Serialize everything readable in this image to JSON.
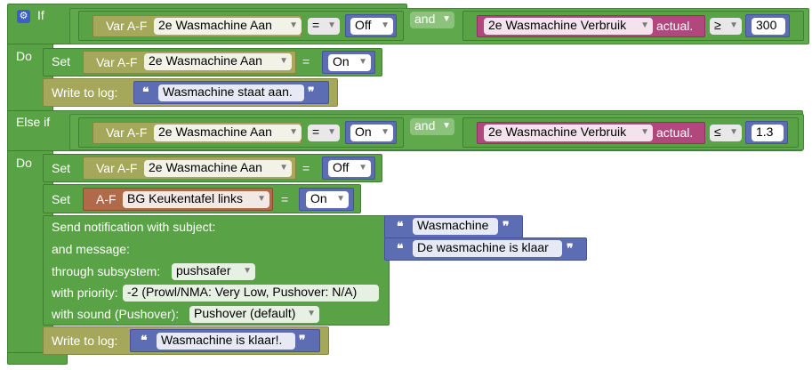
{
  "if_block": {
    "label_if": "If",
    "label_do": "Do",
    "label_else_if": "Else if",
    "label_do2": "Do"
  },
  "cond1": {
    "left_var_label": "Var A-F",
    "left_device": "2e Wasmachine Aan",
    "op": "=",
    "value": "Off",
    "and": "and",
    "right_device": "2e Wasmachine Verbruik",
    "right_suffix": "actual.",
    "cmp": "≥",
    "number": "300"
  },
  "do1": {
    "set_label": "Set",
    "var_label": "Var A-F",
    "device": "2e Wasmachine Aan",
    "eq": "=",
    "value": "On",
    "log_label": "Write to log:",
    "log_text": "Wasmachine staat aan."
  },
  "cond2": {
    "left_var_label": "Var A-F",
    "left_device": "2e Wasmachine Aan",
    "op": "=",
    "value": "On",
    "and": "and",
    "right_device": "2e Wasmachine Verbruik",
    "right_suffix": "actual.",
    "cmp": "≤",
    "number": "1.3"
  },
  "do2": {
    "set1_label": "Set",
    "set1_var_label": "Var A-F",
    "set1_device": "2e Wasmachine Aan",
    "set1_eq": "=",
    "set1_value": "Off",
    "set2_label": "Set",
    "set2_var_label": "A-F",
    "set2_device": "BG Keukentafel links",
    "set2_eq": "=",
    "set2_value": "On",
    "notify": {
      "subject_label": "Send notification with subject:",
      "subject_text": "Wasmachine",
      "message_label": "and message:",
      "message_text": "De wasmachine is klaar",
      "subsystem_label": "through subsystem:",
      "subsystem_value": "pushsafer",
      "priority_label": "with priority:",
      "priority_value": "-2 (Prowl/NMA: Very Low, Pushover: N/A)",
      "sound_label": "with sound (Pushover):",
      "sound_value": "Pushover (default)"
    },
    "log_label": "Write to log:",
    "log_text": "Wasmachine is klaar!."
  },
  "quote_open": "❝",
  "quote_close": "❞",
  "icons": {
    "gear": "gear-icon",
    "dropdown": "chevron-down-icon"
  },
  "colors": {
    "logic": "#59a246",
    "variable": "#a5a85b",
    "device": "#b0487e",
    "device_set": "#b06a4a",
    "text": "#5c6db3"
  }
}
